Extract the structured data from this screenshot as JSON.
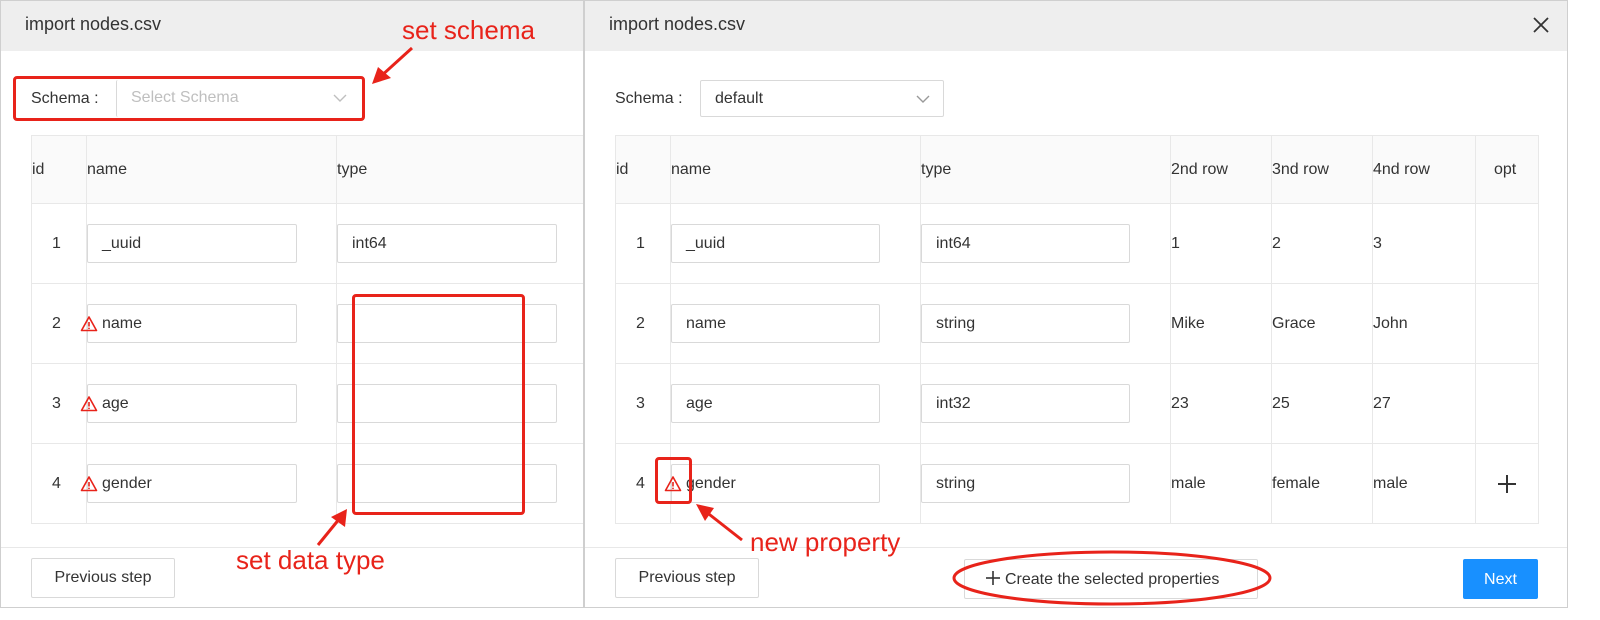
{
  "left_dialog": {
    "title": "import nodes.csv",
    "schema_label": "Schema :",
    "schema_placeholder": "Select Schema",
    "columns": [
      "id",
      "name",
      "type"
    ],
    "rows": [
      {
        "id": "1",
        "name": "_uuid",
        "type": "int64",
        "warning": false
      },
      {
        "id": "2",
        "name": "name",
        "type": "",
        "warning": true
      },
      {
        "id": "3",
        "name": "age",
        "type": "",
        "warning": true
      },
      {
        "id": "4",
        "name": "gender",
        "type": "",
        "warning": true
      }
    ],
    "previous_label": "Previous step"
  },
  "right_dialog": {
    "title": "import nodes.csv",
    "schema_label": "Schema :",
    "schema_value": "default",
    "columns": [
      "id",
      "name",
      "type",
      "2nd row",
      "3nd row",
      "4nd row",
      "opt"
    ],
    "rows": [
      {
        "id": "1",
        "name": "_uuid",
        "type": "int64",
        "r2": "1",
        "r3": "2",
        "r4": "3"
      },
      {
        "id": "2",
        "name": "name",
        "type": "string",
        "r2": "Mike",
        "r3": "Grace",
        "r4": "John"
      },
      {
        "id": "3",
        "name": "age",
        "type": "int32",
        "r2": "23",
        "r3": "25",
        "r4": "27"
      },
      {
        "id": "4",
        "name": "gender",
        "type": "string",
        "r2": "male",
        "r3": "female",
        "r4": "male"
      }
    ],
    "previous_label": "Previous step",
    "create_label": "Create the selected properties",
    "next_label": "Next"
  },
  "annotations": {
    "set_schema": "set schema",
    "set_data_type": "set data type",
    "new_property": "new property"
  },
  "colors": {
    "annotation": "#e8231a",
    "primary": "#1890ff",
    "header_bg": "#eeeeee"
  }
}
